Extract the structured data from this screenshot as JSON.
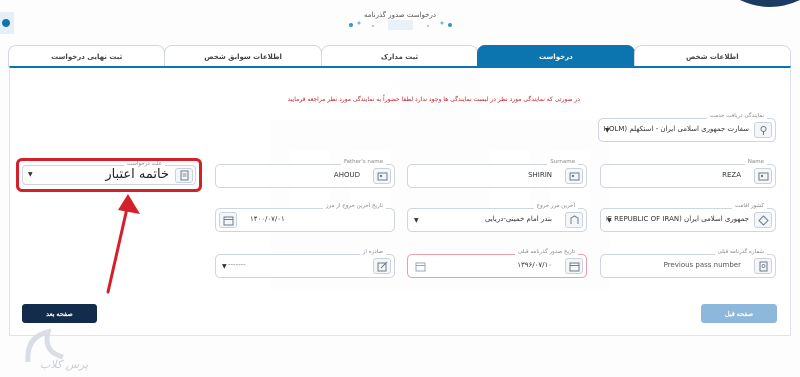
{
  "header": {
    "title": "درخواست صدور گذرنامه"
  },
  "tabs": [
    {
      "label": "اطلاعات شخص",
      "active": false
    },
    {
      "label": "درخواست",
      "active": true
    },
    {
      "label": "ثبت مدارک",
      "active": false
    },
    {
      "label": "اطلاعات سوابق شخص",
      "active": false
    },
    {
      "label": "ثبت نهایی درخواست",
      "active": false
    }
  ],
  "notice": "در صورتی که نمایندگی مورد نظر در لیست نمایندگی ها وجود ندارد لطفا حضوراً به نمایندگی مورد نظر مراجعه فرمایید",
  "form": {
    "service_office": {
      "label": "نمایندگی دریافت خدمت",
      "value": "سفارت جمهوری اسلامی ایران - استکهلم (STOCKHOLM)"
    },
    "name": {
      "label": "Name",
      "value": "REZA"
    },
    "surname": {
      "label": "Surname",
      "value": "SHIRIN"
    },
    "father_name": {
      "label": "Father's name",
      "value": "AHOUD"
    },
    "request_reason": {
      "label": "علت درخواست",
      "value": "خاتمه اعتبار"
    },
    "residence_country": {
      "label": "کشور اقامت",
      "value": "جمهوری اسلامی ایران (ISLAMIC REPUBLIC OF IRAN)"
    },
    "last_exit_border": {
      "label": "آخرین مرز خروج",
      "value": "بندر امام خمینی-دریایی"
    },
    "last_exit_date": {
      "label": "تاریخ آخرین خروج از مرز",
      "value": "۱۴۰۰/۰۷/۰۱"
    },
    "previous_passport_number": {
      "label": "شماره گذرنامه قبلی",
      "value": "Previous pass number"
    },
    "previous_passport_issue_date": {
      "label": "تاریخ صدور گذرنامه قبلی",
      "value": "۱۳۹۶/۰۷/۱۰"
    },
    "issued_from": {
      "label": "صادره از",
      "value": "-------"
    }
  },
  "buttons": {
    "next": "صفحه بعد",
    "prev": "صفحه قبل"
  },
  "brand": {
    "text": "پرس کلاب"
  },
  "colors": {
    "accent": "#0c74ae",
    "highlight": "#d4202a",
    "next_button": "#142c4c",
    "prev_button": "#8db8dc"
  }
}
